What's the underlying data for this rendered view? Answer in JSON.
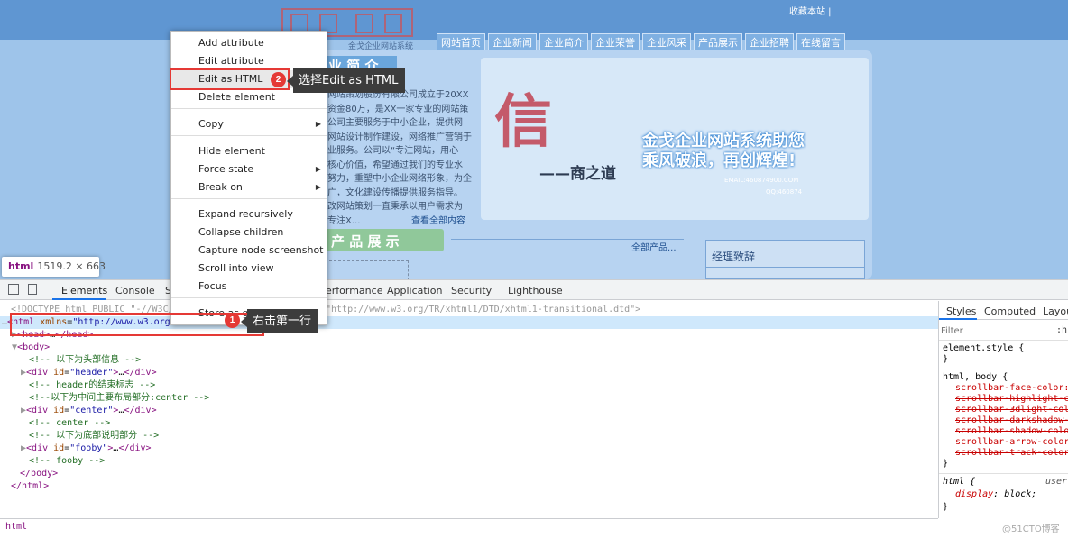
{
  "website": {
    "favorites_text": "收藏本站 |",
    "logo_subtitle": "金戈企业网站系统",
    "nav": [
      "网站首页",
      "企业新闻",
      "企业简介",
      "企业荣誉",
      "企业风采",
      "产品展示",
      "企业招聘",
      "在线留言"
    ],
    "intro_heading": "业 简 介",
    "intro_lines": [
      "网站策划股份有限公司成立于20XX",
      "资金80万，是XX一家专业的网站策",
      "公司主要服务于中小企业，提供网",
      "网站设计制作建设，网络推广营销于",
      "业服务。公司以“专注网站，用心",
      "核心价值，希望通过我们的专业水",
      "努力，重塑中小企业网络形象，为企",
      "广，文化建设传播提供服务指导。",
      "改网站策划一直秉承以用户需求为",
      "专注X..."
    ],
    "intro_more": "查看全部内容",
    "banner_char": "信",
    "banner_subtitle": "——商之道",
    "banner_slogan_1": "金戈企业网站系统助您",
    "banner_slogan_2": "乘风破浪，再创辉煌!",
    "banner_email": "EMAIL:460874900.COM",
    "banner_qq": "QQ:460874",
    "products_heading": "产 品 展 示",
    "products_all": "全部产品...",
    "manager_heading": "经理致辞"
  },
  "tooltip": {
    "tag": "html",
    "dimensions": "1519.2 × 663"
  },
  "devtools": {
    "tabs": [
      "Elements",
      "Console",
      "S",
      "erformance",
      "Application",
      "Security",
      "Lighthouse"
    ],
    "dom": {
      "doctype_prefix": "<!DOCTYPE html PUBLIC \"-//W3C//D",
      "doctype_suffix": "\"http://www.w3.org/TR/xhtml1/DTD/xhtml1-transitional.dtd\">",
      "html_tag": "html",
      "html_attr": "xmlns",
      "html_attr_value": "\"http://www.w3.org/1",
      "head": "head",
      "body": "body",
      "comment_header": "<!-- 以下为头部信息 -->",
      "div_header_id": "\"header\"",
      "comment_header_end": "<!-- header的结束标志 -->",
      "comment_center_layout": "<!--以下为中间主要布局部分:center -->",
      "div_center_id": "\"center\"",
      "comment_center": "<!-- center -->",
      "comment_footer": "<!-- 以下为底部说明部分 -->",
      "div_footer_id": "\"fooby\"",
      "comment_fooby": "<!-- fooby -->"
    },
    "styles": {
      "tabs": [
        "Styles",
        "Computed",
        "Layout"
      ],
      "filter_placeholder": "Filter",
      "hov_label": ":h",
      "element_style": "element.style {",
      "close_brace": "}",
      "selector_html_body": "html, body {",
      "scrollbar_props": [
        "scrollbar-face-color: ",
        "scrollbar-highlight-co",
        "scrollbar-3dlight-colo",
        "scrollbar-darkshadow-c",
        "scrollbar-shadow-color",
        "scrollbar-arrow-color:",
        "scrollbar-track-color:"
      ],
      "selector_html": "html {",
      "user_agent": "user",
      "display_prop": "display",
      "display_value": "block;"
    },
    "breadcrumb": "html"
  },
  "context_menu": {
    "items": [
      "Add attribute",
      "Edit attribute",
      "Edit as HTML",
      "Delete element",
      "Copy",
      "Hide element",
      "Force state",
      "Break on",
      "Expand recursively",
      "Collapse children",
      "Capture node screenshot",
      "Scroll into view",
      "Focus",
      "Store as global variable"
    ],
    "has_submenu": [
      "Copy",
      "Force state",
      "Break on"
    ]
  },
  "annotations": {
    "step1_number": "1",
    "step1_text": "右击第一行",
    "step2_number": "2",
    "step2_text": "选择Edit as HTML"
  },
  "watermark": "@51CTO博客",
  "colors": {
    "accent": "#1a73e8",
    "annotation_red": "#e53935",
    "tag": "#881280",
    "attr": "#994500",
    "value": "#1a1aa6",
    "comment": "#236e25"
  }
}
